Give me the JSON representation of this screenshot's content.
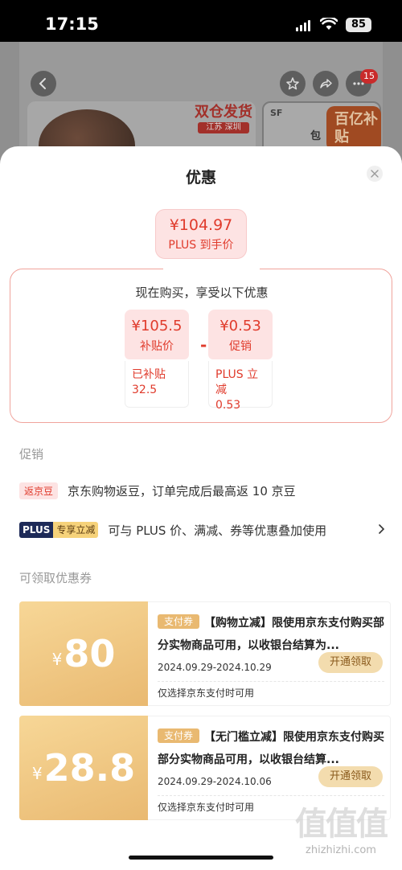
{
  "status_bar": {
    "time": "17:15",
    "battery": "85"
  },
  "background": {
    "notification_count": "15",
    "banner_stamp": "双仓发货",
    "banner_stamp_sub": "江苏 深圳",
    "courier_logo": "SF",
    "courier_text": "包",
    "subsidy_badge": "百亿补贴"
  },
  "sheet": {
    "title": "优惠",
    "final_price": "¥104.97",
    "final_price_label": "PLUS 到手价",
    "calc_heading": "现在购买，享受以下优惠",
    "components": [
      {
        "value": "¥105.5",
        "label": "补贴价",
        "detail_line1": "已补贴",
        "detail_line2": "32.5"
      },
      {
        "value": "¥0.53",
        "label": "促销",
        "detail_line1": "PLUS 立减",
        "detail_line2": "0.53"
      }
    ],
    "operator": "-"
  },
  "promotions": {
    "title": "促销",
    "items": [
      {
        "tag": "返京豆",
        "text": "京东购物返豆，订单完成后最高返 10 京豆"
      },
      {
        "tag_a": "PLUS",
        "tag_b": "专享立减",
        "text": "可与 PLUS 价、满减、券等优惠叠加使用"
      }
    ]
  },
  "coupons": {
    "title": "可领取优惠券",
    "items": [
      {
        "currency": "¥",
        "amount": "80",
        "tag": "支付券",
        "description": "【购物立减】限使用京东支付购买部分实物商品可用，以收银台结算为...",
        "date_range": "2024.09.29-2024.10.29",
        "button": "开通领取",
        "note": "仅选择京东支付时可用"
      },
      {
        "currency": "¥",
        "amount": "28.8",
        "tag": "支付券",
        "description": "【无门槛立减】限使用京东支付购买部分实物商品可用，以收银台结算...",
        "date_range": "2024.09.29-2024.10.06",
        "button": "开通领取",
        "note": "仅选择京东支付时可用"
      }
    ]
  },
  "watermark": {
    "text": "值值值",
    "url": "zhizhizhi.com"
  },
  "colors": {
    "accent_red": "#e03b2c",
    "coupon_gold": "#e9b971",
    "plus_navy": "#1d2a58"
  },
  "icons": [
    "back-arrow-icon",
    "star-icon",
    "share-icon",
    "more-icon",
    "close-icon",
    "chevron-right-icon",
    "wifi-icon",
    "signal-icon"
  ]
}
